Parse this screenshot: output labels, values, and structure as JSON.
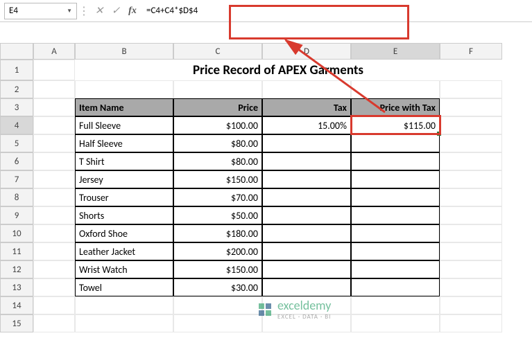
{
  "nameBox": "E4",
  "formula": "=C4+C4*$D$4",
  "columns": [
    "A",
    "B",
    "C",
    "D",
    "E",
    "F"
  ],
  "rows": [
    "1",
    "2",
    "3",
    "4",
    "5",
    "6",
    "7",
    "8",
    "9",
    "10",
    "11",
    "12",
    "13",
    "14",
    "15"
  ],
  "title": "Price Record of APEX Garments",
  "headers": {
    "item": "Item Name",
    "price": "Price",
    "tax": "Tax",
    "pwt": "Price with Tax"
  },
  "taxValue": "15.00%",
  "resultValue": "$115.00",
  "items": [
    {
      "name": "Full Sleeve",
      "price": "$100.00"
    },
    {
      "name": "Half Sleeve",
      "price": "$80.00"
    },
    {
      "name": "T Shirt",
      "price": "$80.00"
    },
    {
      "name": "Jersey",
      "price": "$150.00"
    },
    {
      "name": "Trouser",
      "price": "$70.00"
    },
    {
      "name": "Shorts",
      "price": "$50.00"
    },
    {
      "name": "Oxford Shoe",
      "price": "$180.00"
    },
    {
      "name": "Leather Jacket",
      "price": "$200.00"
    },
    {
      "name": "Wrist Watch",
      "price": "$150.00"
    },
    {
      "name": "Towel",
      "price": "$30.00"
    }
  ],
  "watermark": {
    "name": "exceldemy",
    "sub": "EXCEL · DATA · BI"
  },
  "chart_data": {
    "type": "table",
    "title": "Price Record of APEX Garments",
    "columns": [
      "Item Name",
      "Price",
      "Tax",
      "Price with Tax"
    ],
    "rows": [
      [
        "Full Sleeve",
        100.0,
        0.15,
        115.0
      ],
      [
        "Half Sleeve",
        80.0,
        null,
        null
      ],
      [
        "T Shirt",
        80.0,
        null,
        null
      ],
      [
        "Jersey",
        150.0,
        null,
        null
      ],
      [
        "Trouser",
        70.0,
        null,
        null
      ],
      [
        "Shorts",
        50.0,
        null,
        null
      ],
      [
        "Oxford Shoe",
        180.0,
        null,
        null
      ],
      [
        "Leather Jacket",
        200.0,
        null,
        null
      ],
      [
        "Wrist Watch",
        150.0,
        null,
        null
      ],
      [
        "Towel",
        30.0,
        null,
        null
      ]
    ],
    "formula_cell": "E4",
    "formula": "=C4+C4*$D$4"
  }
}
